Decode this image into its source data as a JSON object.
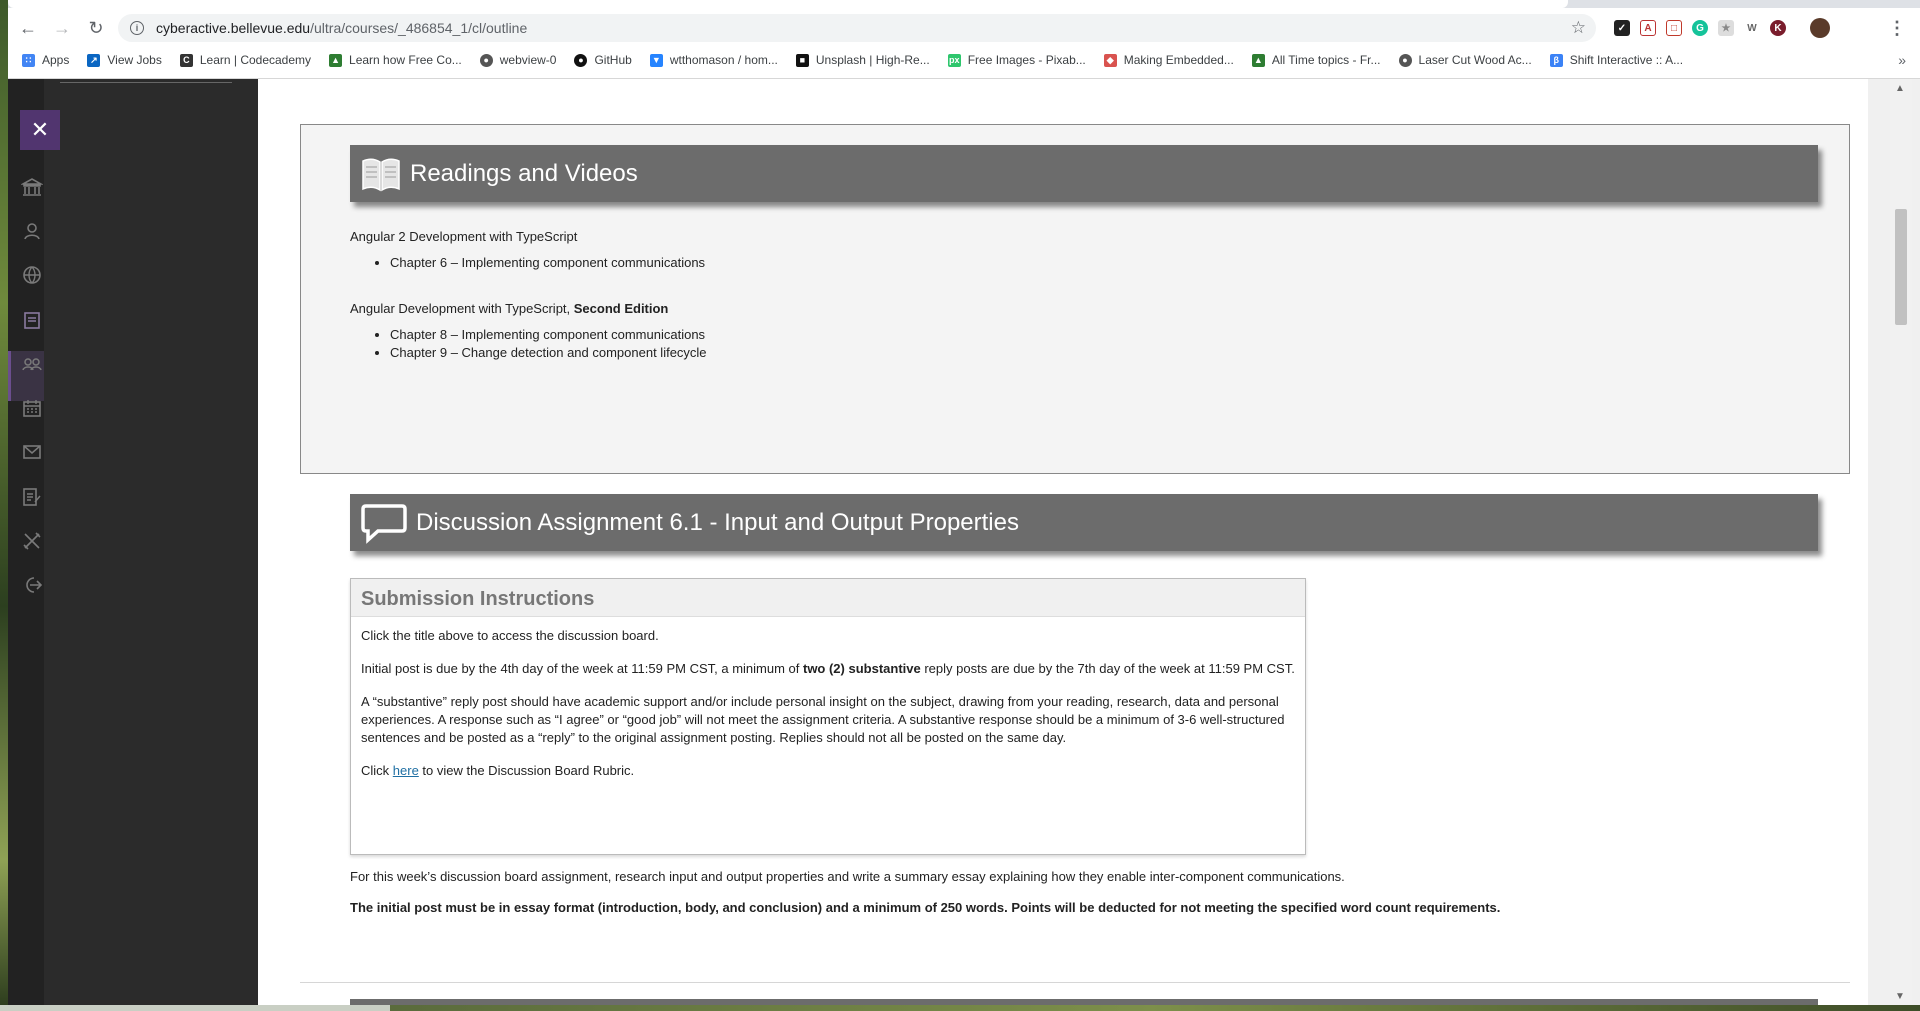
{
  "browser": {
    "url_host": "cyberactive.bellevue.edu",
    "url_path": "/ultra/courses/_486854_1/cl/outline",
    "bookmarks": [
      {
        "label": "Apps",
        "icon": "apps-grid-icon",
        "color": "#4285f4"
      },
      {
        "label": "View Jobs",
        "icon": "linkedin-jobs-icon",
        "color": "#0a66c2"
      },
      {
        "label": "Learn | Codecademy",
        "icon": "codecademy-icon",
        "color": "#333333"
      },
      {
        "label": "Learn how Free Co...",
        "icon": "green-doc-icon",
        "color": "#2e7d32"
      },
      {
        "label": "webview-0",
        "icon": "globe-icon",
        "color": "#555555"
      },
      {
        "label": "GitHub",
        "icon": "github-icon",
        "color": "#111111"
      },
      {
        "label": "wtthomason / hom...",
        "icon": "bitbucket-icon",
        "color": "#2684ff"
      },
      {
        "label": "Unsplash | High-Re...",
        "icon": "unsplash-icon",
        "color": "#111111"
      },
      {
        "label": "Free Images - Pixab...",
        "icon": "pixabay-icon",
        "color": "#2ec66d"
      },
      {
        "label": "Making Embedded...",
        "icon": "embedded-icon",
        "color": "#d9534f"
      },
      {
        "label": "All Time topics - Fr...",
        "icon": "green-doc-icon",
        "color": "#2e7d32"
      },
      {
        "label": "Laser Cut Wood Ac...",
        "icon": "globe-icon",
        "color": "#555555"
      },
      {
        "label": "Shift Interactive :: A...",
        "icon": "shift-icon",
        "color": "#3b82f6"
      }
    ]
  },
  "readings": {
    "title": "Readings and Videos",
    "book1": "Angular 2 Development with TypeScript",
    "book1_chapters": [
      "Chapter 6 – Implementing component communications"
    ],
    "book2_prefix": "Angular Development with TypeScript, ",
    "book2_bold": "Second Edition",
    "book2_chapters": [
      "Chapter 8 – Implementing component communications",
      "Chapter 9 – Change detection and component lifecycle"
    ]
  },
  "discussion": {
    "title": "Discussion Assignment 6.1 - Input and Output Properties",
    "instructions_heading": "Submission Instructions",
    "p1": "Click the title above to access the discussion board.",
    "p2_a": "Initial post is due by the 4th day of the week at 11:59 PM CST, a minimum of ",
    "p2_bold": "two (2) substantive",
    "p2_b": " reply posts are due by the 7th day of the week at 11:59 PM CST.",
    "p3": "A “substantive” reply post should have academic support and/or include personal insight on the subject, drawing from your reading, research, data and personal experiences. A response such as “I agree” or “good job” will not meet the assignment criteria. A substantive response should be a minimum of 3-6 well-structured sentences and be posted as a “reply” to the original assignment posting. Replies should not all be posted on the same day.",
    "p4_a": "Click ",
    "p4_link": "here",
    "p4_b": " to view the Discussion Board Rubric.",
    "summary": "For this week’s discussion board assignment, research input and output properties and write a summary essay explaining how they enable inter-component communications.",
    "requirement": "The initial post must be in essay format (introduction, body, and conclusion) and a minimum of 250 words.  Points will be deducted for not meeting the specified word count requirements."
  },
  "colors": {
    "band": "#6c6c6c",
    "close_button": "#51356f",
    "link": "#1f6fa3"
  }
}
